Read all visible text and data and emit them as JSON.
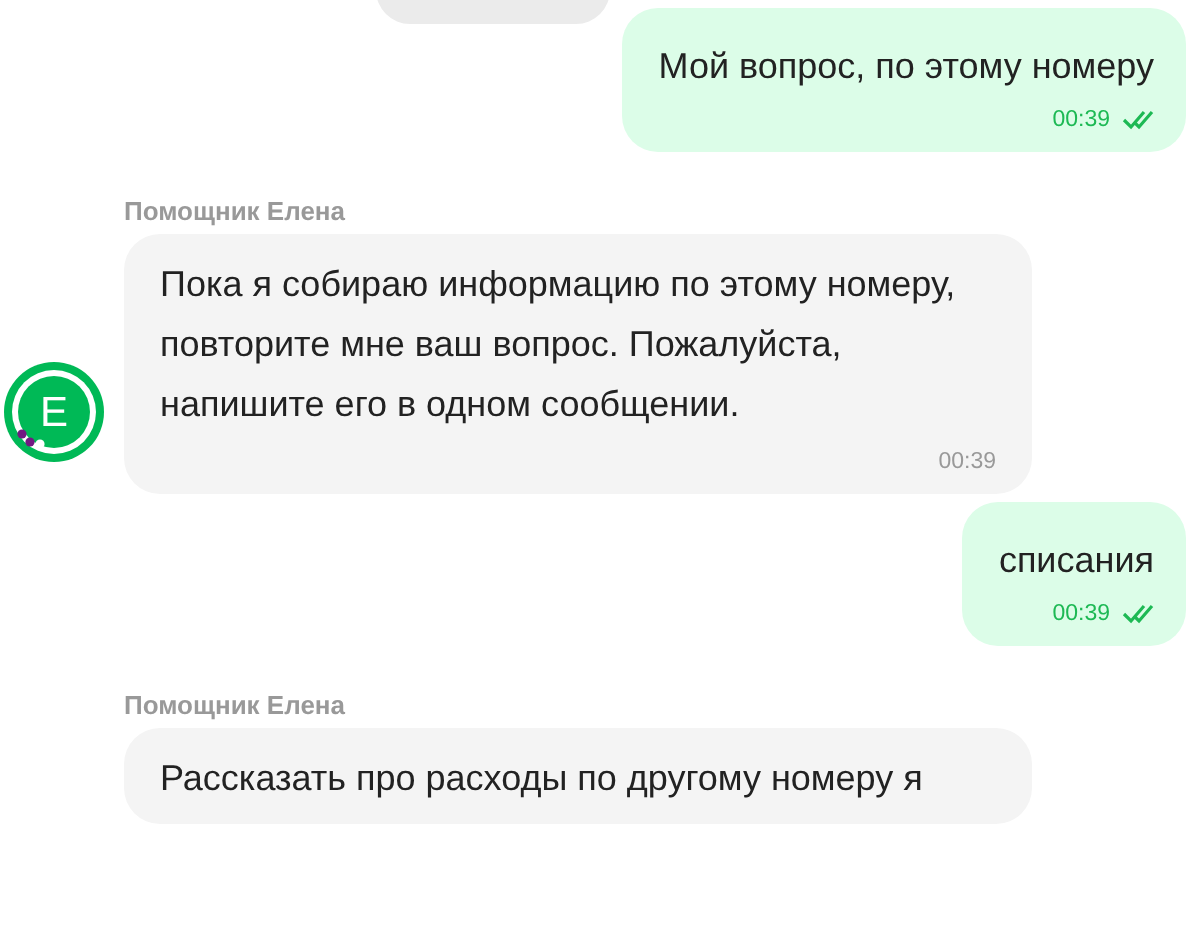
{
  "messages": [
    {
      "kind": "outgoing",
      "text": "Мой вопрос, по этому номеру",
      "time": "00:39",
      "read": true
    },
    {
      "kind": "incoming",
      "sender": "Помощник Елена",
      "text": "Пока я собираю информацию по этому номеру, повторите мне ваш вопрос. Пожалуйста, напишите его в одном сообщении.",
      "time": "00:39",
      "avatar": "Е"
    },
    {
      "kind": "outgoing",
      "text": "списания",
      "time": "00:39",
      "read": true
    },
    {
      "kind": "incoming",
      "sender": "Помощник Елена",
      "text": "Рассказать про расходы по другому номеру я"
    }
  ]
}
